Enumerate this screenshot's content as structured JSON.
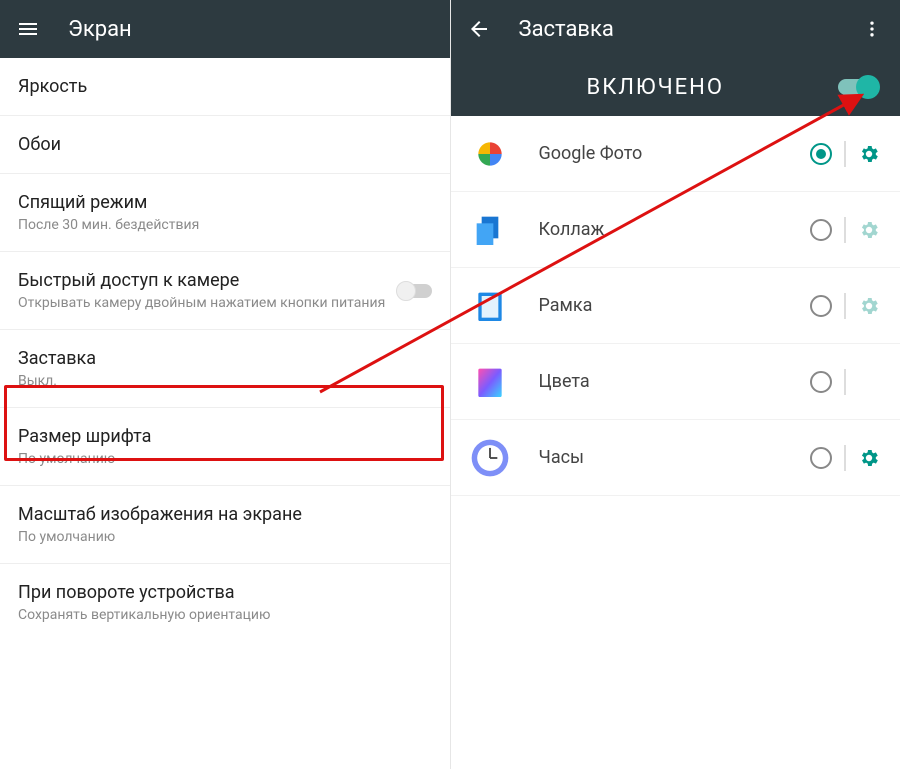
{
  "left": {
    "title": "Экран",
    "items": [
      {
        "primary": "Яркость"
      },
      {
        "primary": "Обои"
      },
      {
        "primary": "Спящий режим",
        "secondary": "После 30 мин. бездействия"
      },
      {
        "primary": "Быстрый доступ к камере",
        "secondary": "Открывать камеру двойным нажатием кнопки питания",
        "switch": true
      },
      {
        "primary": "Заставка",
        "secondary": "Выкл."
      },
      {
        "primary": "Размер шрифта",
        "secondary": "По умолчанию"
      },
      {
        "primary": "Масштаб изображения на экране",
        "secondary": "По умолчанию"
      },
      {
        "primary": "При повороте устройства",
        "secondary": "Сохранять вертикальную ориентацию"
      }
    ]
  },
  "right": {
    "title": "Заставка",
    "enabled_label": "ВКЛЮЧЕНО",
    "options": [
      {
        "label": "Google Фото",
        "selected": true,
        "has_gear": true,
        "gear_strong": true
      },
      {
        "label": "Коллаж",
        "selected": false,
        "has_gear": true,
        "gear_strong": false
      },
      {
        "label": "Рамка",
        "selected": false,
        "has_gear": true,
        "gear_strong": false
      },
      {
        "label": "Цвета",
        "selected": false,
        "has_gear": false,
        "gear_strong": false
      },
      {
        "label": "Часы",
        "selected": false,
        "has_gear": true,
        "gear_strong": true
      }
    ]
  }
}
